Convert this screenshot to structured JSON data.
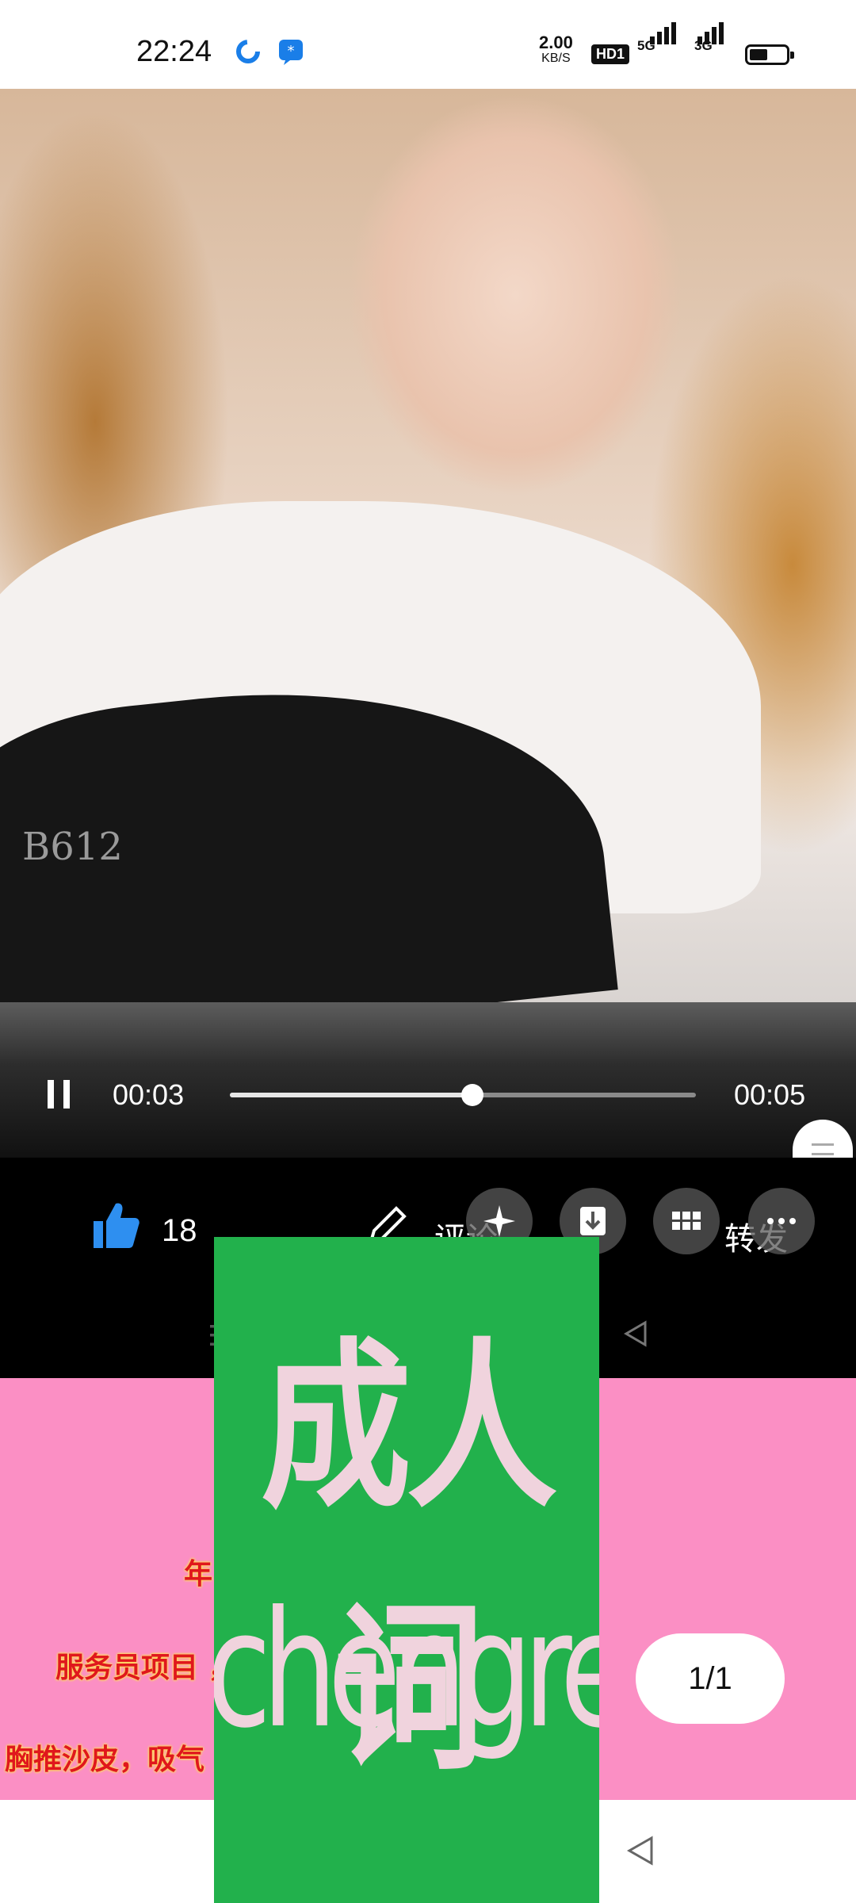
{
  "status_bar": {
    "time": "22:24",
    "speed_value": "2.00",
    "speed_unit": "KB/S",
    "hd_badge": "HD1",
    "net1": "5G",
    "net2": "3G"
  },
  "video": {
    "watermark": "B612",
    "current_time": "00:03",
    "total_time": "00:05",
    "progress": 0.52
  },
  "actions": {
    "like_count": "18",
    "comment_label": "评论",
    "share_label": "转发"
  },
  "promo": {
    "lines": [
      "年                                              胸围C",
      "服务员项目                                   ，  技          ，",
      "胸推沙皮，吸气                               月，激情啪啪      ，"
    ]
  },
  "ad": {
    "title": "成人词",
    "url": "chengrenci.com"
  },
  "page_indicator": "1/1",
  "colors": {
    "like_blue": "#2e8ff0",
    "promo_pink": "#fb8fc4",
    "ad_green": "#22b14c"
  }
}
